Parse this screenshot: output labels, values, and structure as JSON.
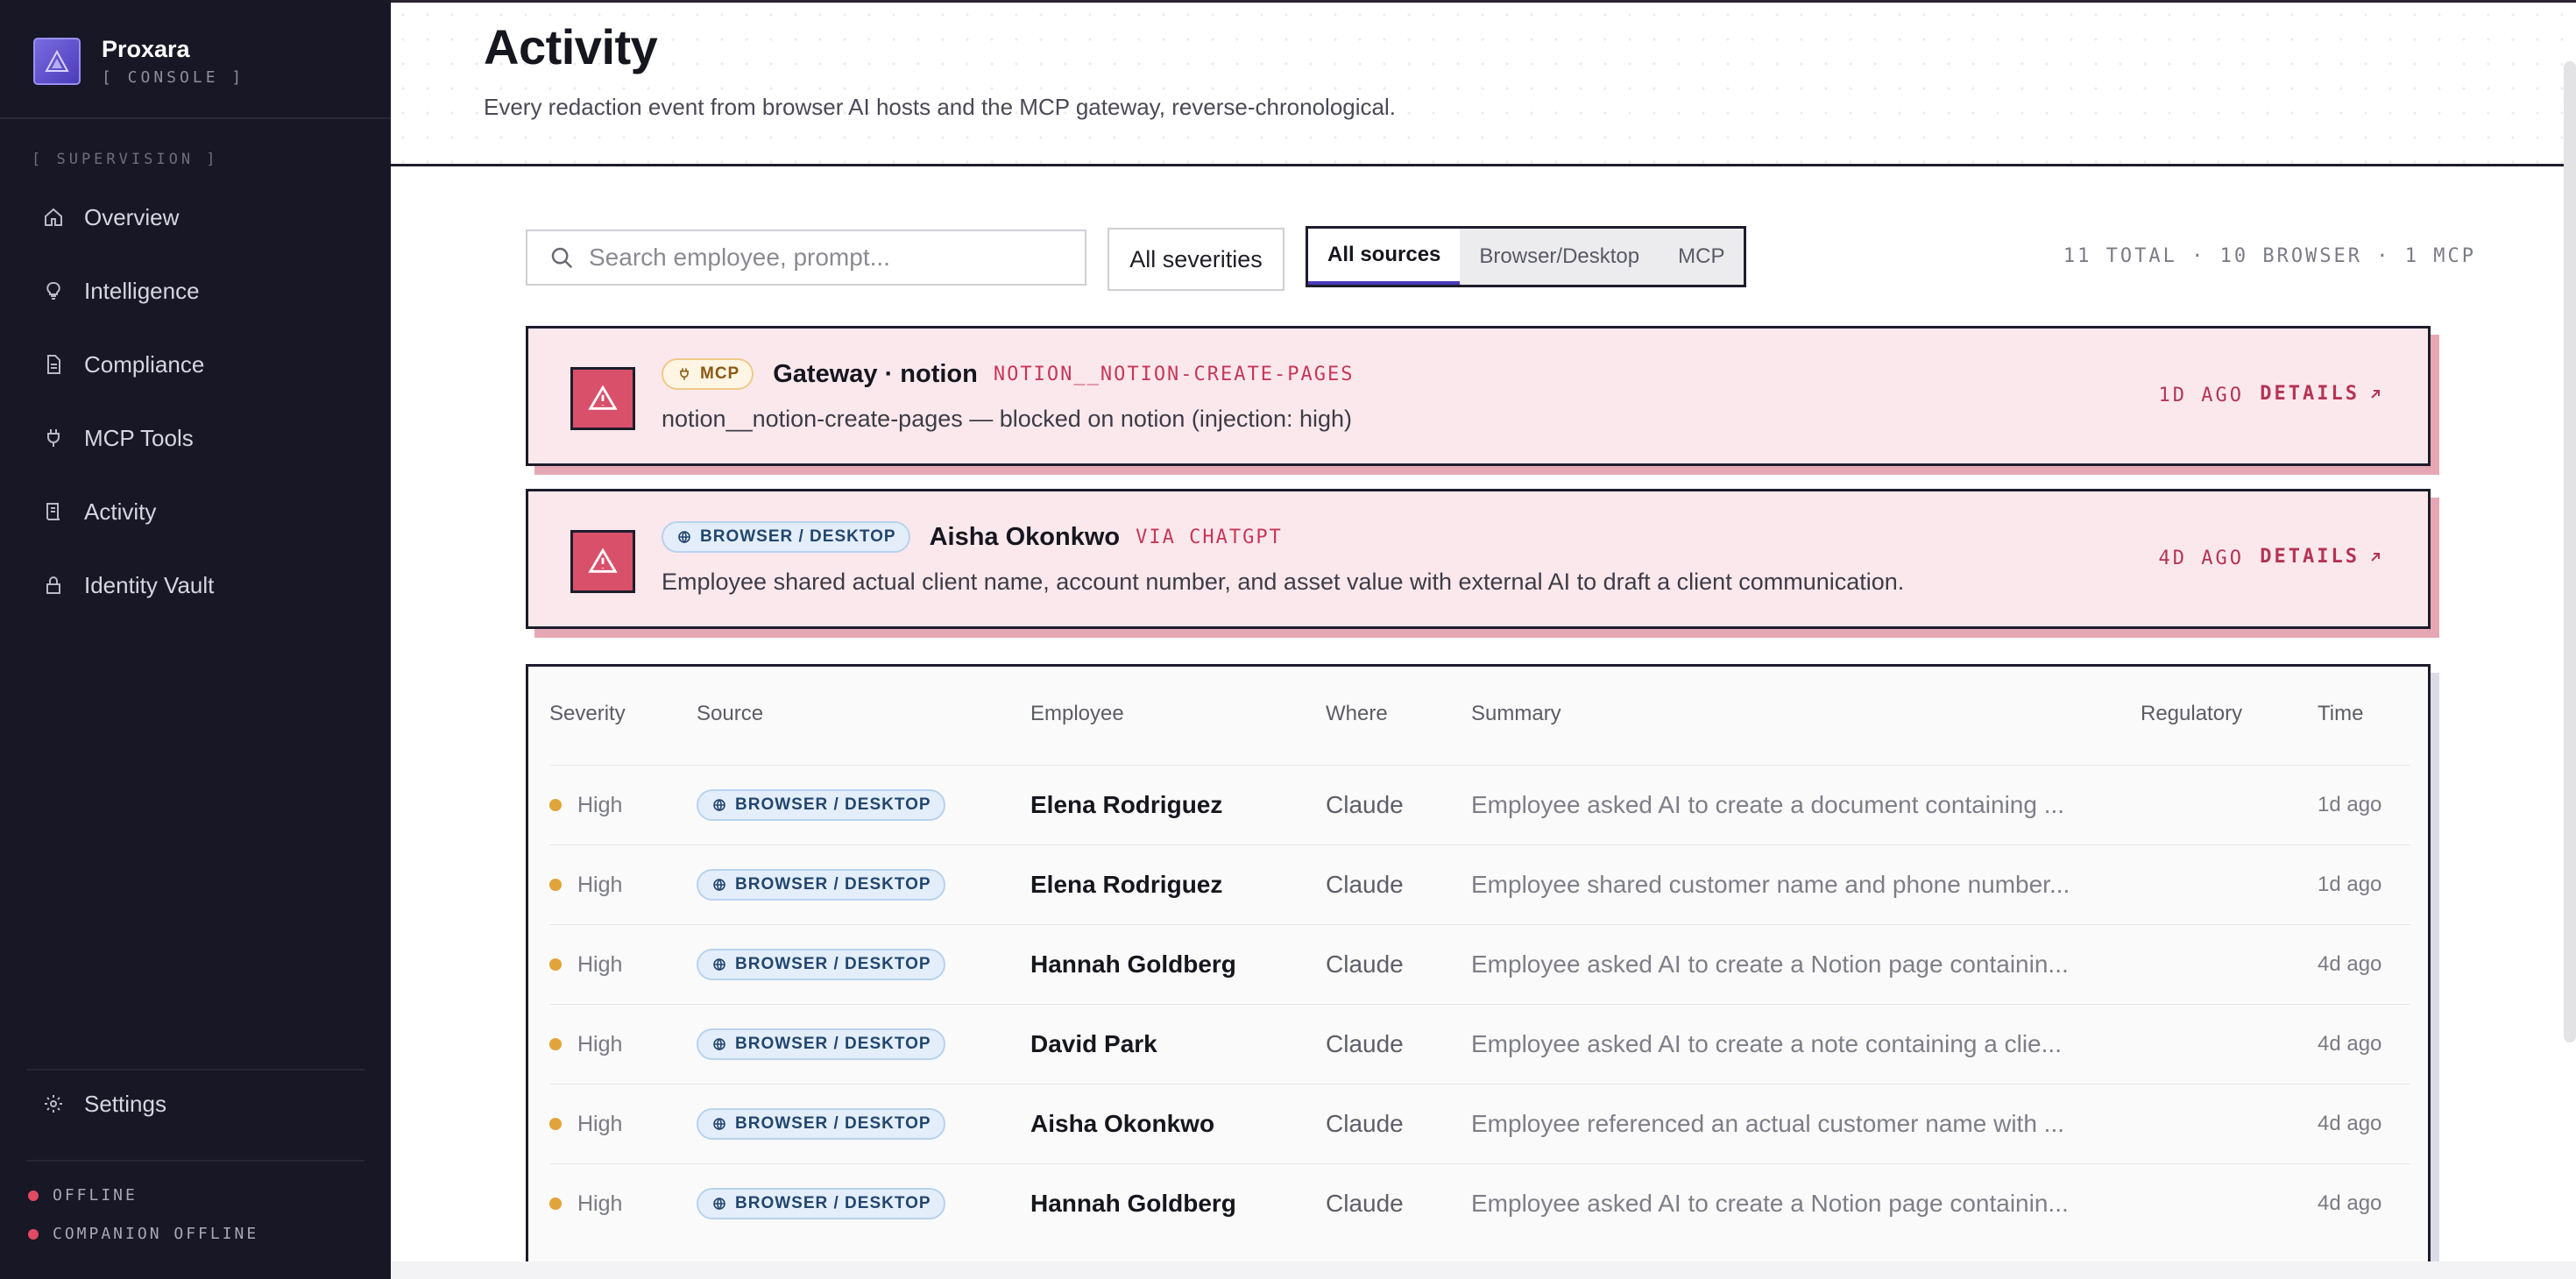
{
  "brand": {
    "name": "Proxara",
    "sub": "[ CONSOLE ]"
  },
  "sidebar": {
    "section_label": "[ SUPERVISION ]",
    "items": [
      {
        "label": "Overview",
        "icon": "home-icon"
      },
      {
        "label": "Intelligence",
        "icon": "lightbulb-icon"
      },
      {
        "label": "Compliance",
        "icon": "document-icon"
      },
      {
        "label": "MCP Tools",
        "icon": "plug-icon"
      },
      {
        "label": "Activity",
        "icon": "scroll-icon"
      },
      {
        "label": "Identity Vault",
        "icon": "lock-icon"
      }
    ],
    "settings_label": "Settings",
    "status": [
      {
        "label": "OFFLINE"
      },
      {
        "label": "COMPANION OFFLINE"
      }
    ]
  },
  "header": {
    "title": "Activity",
    "subtitle": "Every redaction event from browser AI hosts and the MCP gateway, reverse-chronological."
  },
  "filters": {
    "search_placeholder": "Search employee, prompt...",
    "severity_label": "All severities",
    "sources": [
      "All sources",
      "Browser/Desktop",
      "MCP"
    ],
    "totals": "11 TOTAL · 10 BROWSER · 1 MCP"
  },
  "alerts": [
    {
      "badge": "MCP",
      "name": "Gateway · notion",
      "tag": "NOTION__NOTION-CREATE-PAGES",
      "description": "notion__notion-create-pages — blocked on notion (injection: high)",
      "age": "1D AGO",
      "details": "DETAILS"
    },
    {
      "badge": "BROWSER / DESKTOP",
      "name": "Aisha Okonkwo",
      "tag": "VIA CHATGPT",
      "description": "Employee shared actual client name, account number, and asset value with external AI to draft a client communication.",
      "age": "4D AGO",
      "details": "DETAILS"
    }
  ],
  "table": {
    "columns": [
      "Severity",
      "Source",
      "Employee",
      "Where",
      "Summary",
      "Regulatory",
      "Time"
    ],
    "rows": [
      {
        "severity": "High",
        "source": "BROWSER / DESKTOP",
        "employee": "Elena Rodriguez",
        "where": "Claude",
        "summary": "Employee asked AI to create a document containing ...",
        "regulatory": "",
        "time": "1d ago"
      },
      {
        "severity": "High",
        "source": "BROWSER / DESKTOP",
        "employee": "Elena Rodriguez",
        "where": "Claude",
        "summary": "Employee shared customer name and phone number...",
        "regulatory": "",
        "time": "1d ago"
      },
      {
        "severity": "High",
        "source": "BROWSER / DESKTOP",
        "employee": "Hannah Goldberg",
        "where": "Claude",
        "summary": "Employee asked AI to create a Notion page containin...",
        "regulatory": "",
        "time": "4d ago"
      },
      {
        "severity": "High",
        "source": "BROWSER / DESKTOP",
        "employee": "David Park",
        "where": "Claude",
        "summary": "Employee asked AI to create a note containing a clie...",
        "regulatory": "",
        "time": "4d ago"
      },
      {
        "severity": "High",
        "source": "BROWSER / DESKTOP",
        "employee": "Aisha Okonkwo",
        "where": "Claude",
        "summary": "Employee referenced an actual customer name with ...",
        "regulatory": "",
        "time": "4d ago"
      },
      {
        "severity": "High",
        "source": "BROWSER / DESKTOP",
        "employee": "Hannah Goldberg",
        "where": "Claude",
        "summary": "Employee asked AI to create a Notion page containin...",
        "regulatory": "",
        "time": "4d ago"
      }
    ]
  },
  "colors": {
    "sidebar_bg": "#171726",
    "accent": "#4b3cb8",
    "alert_bg": "#fbe8ec",
    "alert_text": "#b43455",
    "severity_high": "#e0a43a",
    "offline": "#e04a62"
  }
}
